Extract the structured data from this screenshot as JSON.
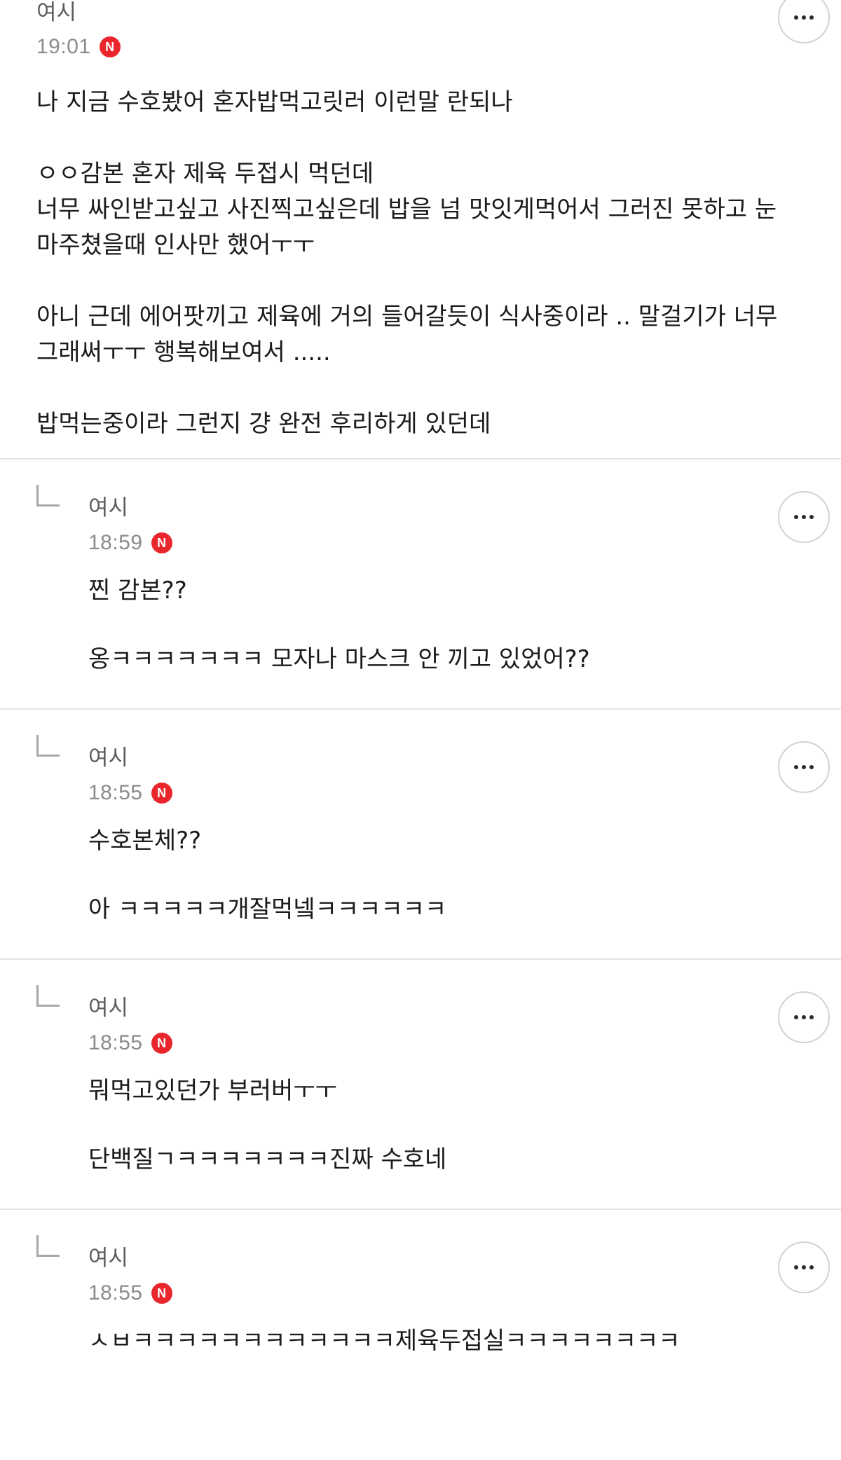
{
  "comments": [
    {
      "nickname": "여시",
      "time": "19:01",
      "badge": "N",
      "text": "나 지금 수호봤어 혼자밥먹고릿러 이런말 란되나\n\nㅇㅇ감본 혼자 제육 두접시 먹던데\n너무 싸인받고싶고 사진찍고싶은데 밥을 넘 맛잇게먹어서 그러진 못하고 눈 마주쳤을때 인사만 했어ㅜㅜ\n\n아니 근데 에어팟끼고 제육에 거의 들어갈듯이 식사중이라 .. 말걸기가 너무 그래써ㅜㅜ 행복해보여서 .....\n\n밥먹는중이라 그런지 걍 완전 후리하게 있던데",
      "more_icon": "more-options-icon"
    },
    {
      "nickname": "여시",
      "time": "18:59",
      "badge": "N",
      "text": "찐 감본??\n\n옹ㅋㅋㅋㅋㅋㅋㅋ 모자나 마스크 안 끼고 있었어??",
      "more_icon": "more-options-icon"
    },
    {
      "nickname": "여시",
      "time": "18:55",
      "badge": "N",
      "text": "수호본체??\n\n아 ㅋㅋㅋㅋㅋ개잘먹넼ㅋㅋㅋㅋㅋㅋ",
      "more_icon": "more-options-icon"
    },
    {
      "nickname": "여시",
      "time": "18:55",
      "badge": "N",
      "text": "뭐먹고있던가 부러버ㅜㅜ\n\n단백질ㄱㅋㅋㅋㅋㅋㅋㅋ진짜 수호네",
      "more_icon": "more-options-icon"
    },
    {
      "nickname": "여시",
      "time": "18:55",
      "badge": "N",
      "text": "ㅅㅂㅋㅋㅋㅋㅋㅋㅋㅋㅋㅋㅋㅋ제육두접실ㅋㅋㅋㅋㅋㅋㅋㅋ",
      "more_icon": "more-options-icon"
    }
  ],
  "colors": {
    "badge": "#e8262b",
    "nickname": "#5c5c5c",
    "time": "#8b8b8b",
    "divider": "#e4e4e4"
  }
}
